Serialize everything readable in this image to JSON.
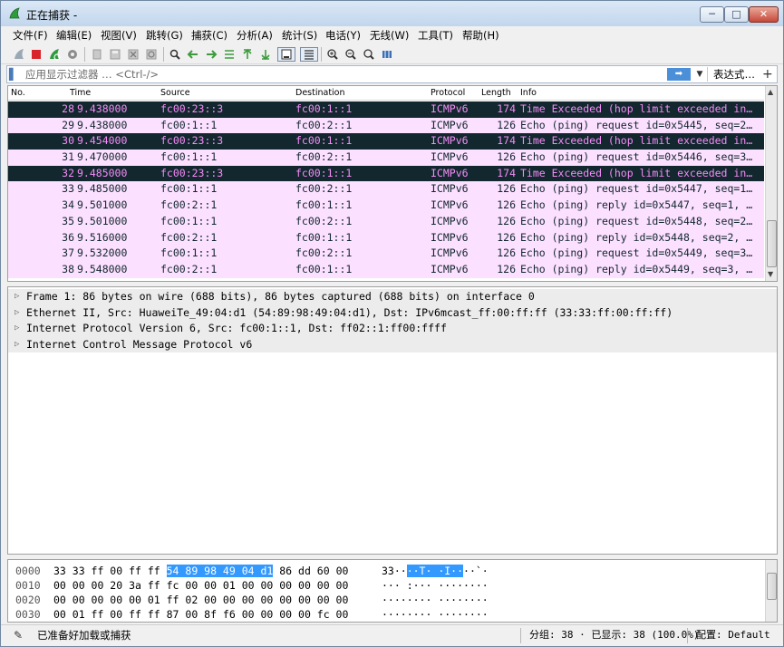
{
  "window": {
    "title": "正在捕获 -",
    "controls": {
      "minimize": "─",
      "maximize": "□",
      "close": "✕"
    }
  },
  "menu": [
    "文件(F)",
    "编辑(E)",
    "视图(V)",
    "跳转(G)",
    "捕获(C)",
    "分析(A)",
    "统计(S)",
    "电话(Y)",
    "无线(W)",
    "工具(T)",
    "帮助(H)"
  ],
  "toolbar": {
    "icons": [
      "shark-fin-start-icon",
      "stop-icon",
      "restart-icon",
      "options-gear-icon",
      "open-file-icon",
      "save-file-icon",
      "close-file-icon",
      "reload-icon",
      "find-icon",
      "go-back-icon",
      "go-forward-icon",
      "go-to-packet-icon",
      "first-packet-icon",
      "last-packet-icon",
      "autoscroll-icon",
      "colorize-icon",
      "zoom-in-icon",
      "zoom-out-icon",
      "zoom-normal-icon",
      "resize-columns-icon"
    ]
  },
  "filter": {
    "placeholder": "应用显示过滤器 … <Ctrl-/>",
    "apply_label": "➡",
    "expression_label": "表达式…",
    "add_label": "+"
  },
  "packet_list": {
    "columns": [
      "No.",
      "Time",
      "Source",
      "Destination",
      "Protocol",
      "Length",
      "Info"
    ],
    "rows": [
      {
        "no": "28",
        "time": "9.438000",
        "src": "fc00:23::3",
        "dst": "fc00:1::1",
        "proto": "ICMPv6",
        "len": "174",
        "info": "Time Exceeded (hop limit exceeded in…",
        "type": "err"
      },
      {
        "no": "29",
        "time": "9.438000",
        "src": "fc00:1::1",
        "dst": "fc00:2::1",
        "proto": "ICMPv6",
        "len": "126",
        "info": "Echo (ping) request id=0x5445, seq=2…",
        "type": "echo"
      },
      {
        "no": "30",
        "time": "9.454000",
        "src": "fc00:23::3",
        "dst": "fc00:1::1",
        "proto": "ICMPv6",
        "len": "174",
        "info": "Time Exceeded (hop limit exceeded in…",
        "type": "err"
      },
      {
        "no": "31",
        "time": "9.470000",
        "src": "fc00:1::1",
        "dst": "fc00:2::1",
        "proto": "ICMPv6",
        "len": "126",
        "info": "Echo (ping) request id=0x5446, seq=3…",
        "type": "echo"
      },
      {
        "no": "32",
        "time": "9.485000",
        "src": "fc00:23::3",
        "dst": "fc00:1::1",
        "proto": "ICMPv6",
        "len": "174",
        "info": "Time Exceeded (hop limit exceeded in…",
        "type": "err"
      },
      {
        "no": "33",
        "time": "9.485000",
        "src": "fc00:1::1",
        "dst": "fc00:2::1",
        "proto": "ICMPv6",
        "len": "126",
        "info": "Echo (ping) request id=0x5447, seq=1…",
        "type": "echo"
      },
      {
        "no": "34",
        "time": "9.501000",
        "src": "fc00:2::1",
        "dst": "fc00:1::1",
        "proto": "ICMPv6",
        "len": "126",
        "info": "Echo (ping) reply id=0x5447, seq=1, …",
        "type": "echo"
      },
      {
        "no": "35",
        "time": "9.501000",
        "src": "fc00:1::1",
        "dst": "fc00:2::1",
        "proto": "ICMPv6",
        "len": "126",
        "info": "Echo (ping) request id=0x5448, seq=2…",
        "type": "echo"
      },
      {
        "no": "36",
        "time": "9.516000",
        "src": "fc00:2::1",
        "dst": "fc00:1::1",
        "proto": "ICMPv6",
        "len": "126",
        "info": "Echo (ping) reply id=0x5448, seq=2, …",
        "type": "echo"
      },
      {
        "no": "37",
        "time": "9.532000",
        "src": "fc00:1::1",
        "dst": "fc00:2::1",
        "proto": "ICMPv6",
        "len": "126",
        "info": "Echo (ping) request id=0x5449, seq=3…",
        "type": "echo"
      },
      {
        "no": "38",
        "time": "9.548000",
        "src": "fc00:2::1",
        "dst": "fc00:1::1",
        "proto": "ICMPv6",
        "len": "126",
        "info": "Echo (ping) reply id=0x5449, seq=3, …",
        "type": "echo"
      }
    ]
  },
  "details": [
    "Frame 1: 86 bytes on wire (688 bits), 86 bytes captured (688 bits) on interface 0",
    "Ethernet II, Src: HuaweiTe_49:04:d1 (54:89:98:49:04:d1), Dst: IPv6mcast_ff:00:ff:ff (33:33:ff:00:ff:ff)",
    "Internet Protocol Version 6, Src: fc00:1::1, Dst: ff02::1:ff00:ffff",
    "Internet Control Message Protocol v6"
  ],
  "bytes": [
    {
      "offset": "0000",
      "hex_pre": "33 33 ff 00 ff ff ",
      "hex_hl": "54 89  98 49 04 d1",
      "hex_post": " 86 dd 60 00",
      "ascii_pre": "33··",
      "ascii_hl": "··T· ·I··",
      "ascii_post": "··`·"
    },
    {
      "offset": "0010",
      "hex_pre": "00 00 00 20 3a ff fc 00  00 01 00 00 00 00 00 00",
      "hex_hl": "",
      "hex_post": "",
      "ascii_pre": "··· :··· ········",
      "ascii_hl": "",
      "ascii_post": ""
    },
    {
      "offset": "0020",
      "hex_pre": "00 00 00 00 00 01 ff 02  00 00 00 00 00 00 00 00",
      "hex_hl": "",
      "hex_post": "",
      "ascii_pre": "········ ········",
      "ascii_hl": "",
      "ascii_post": ""
    },
    {
      "offset": "0030",
      "hex_pre": "00 01 ff 00 ff ff 87 00  8f f6 00 00 00 00 fc 00",
      "hex_hl": "",
      "hex_post": "",
      "ascii_pre": "········ ········",
      "ascii_hl": "",
      "ascii_post": ""
    }
  ],
  "status": {
    "message": "已准备好加载或捕获",
    "packets": "分组: 38 · 已显示: 38 (100.0%)",
    "profile": "配置: Default"
  },
  "colors": {
    "echo_bg": "#fce0ff",
    "error_bg": "#12272e",
    "error_fg": "#f78bf8",
    "highlight": "#3399ff"
  }
}
